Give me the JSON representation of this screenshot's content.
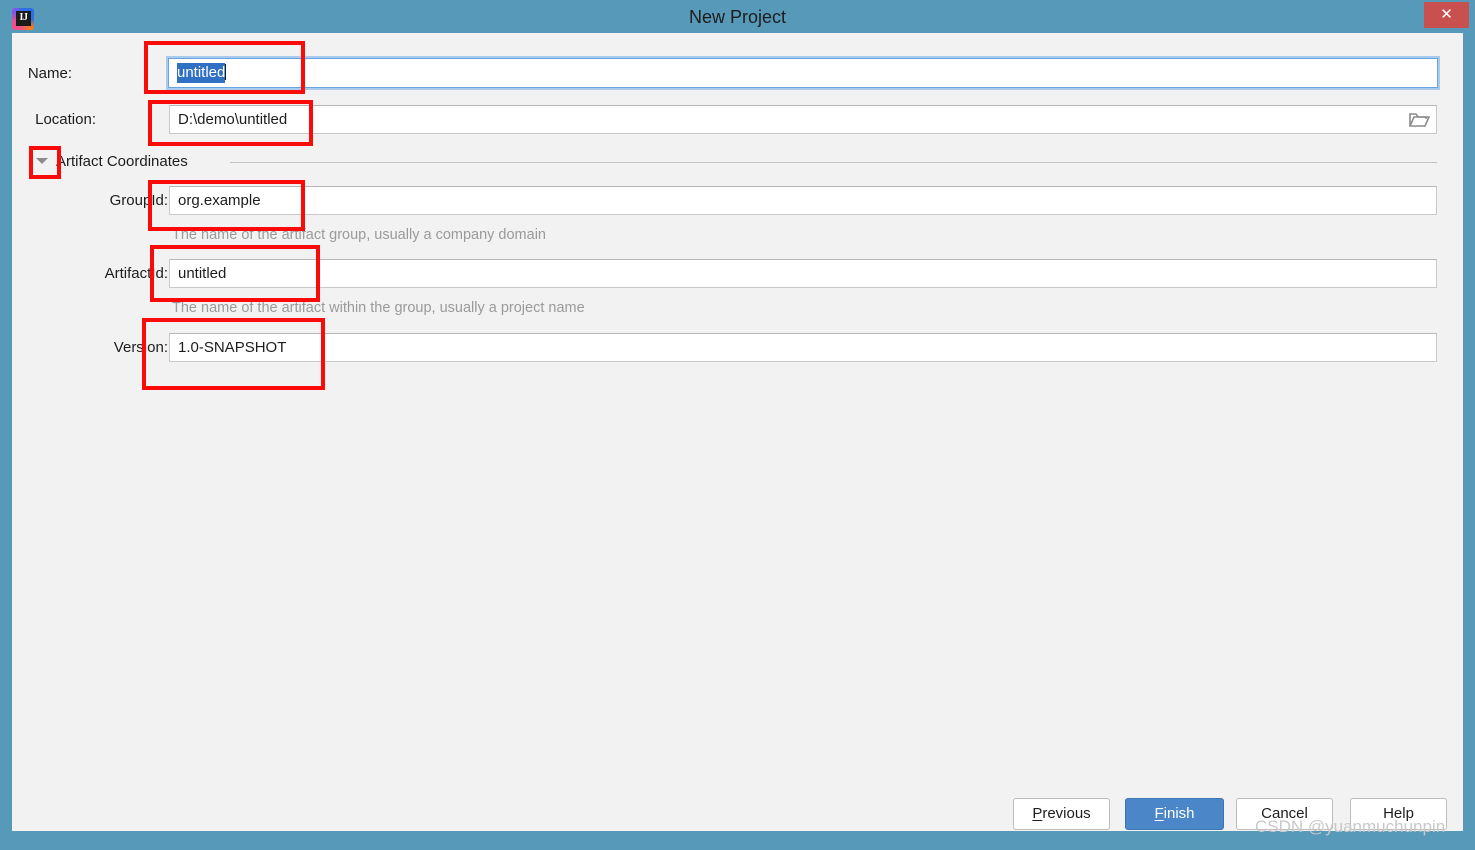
{
  "window": {
    "title": "New Project",
    "app_icon": "intellij-idea-icon",
    "icon_text": "IJ",
    "close_label": "✕",
    "accent_color": "#5699b8",
    "close_color": "#c8504f",
    "body_color": "#f2f2f2"
  },
  "form": {
    "name": {
      "label": "Name:",
      "value": "untitled",
      "selected": true,
      "focused": true
    },
    "location": {
      "label": "Location:",
      "value": "D:\\demo\\untitled",
      "browse_icon": "folder-icon"
    },
    "artifact_section": {
      "title": "Artifact Coordinates",
      "expanded": true,
      "toggle_icon": "chevron-down-icon"
    },
    "group_id": {
      "label": "GroupId:",
      "value": "org.example",
      "hint": "The name of the artifact group, usually a company domain"
    },
    "artifact_id": {
      "label": "ArtifactId:",
      "value": "untitled",
      "hint": "The name of the artifact within the group, usually a project name"
    },
    "version": {
      "label": "Version:",
      "value": "1.0-SNAPSHOT"
    }
  },
  "buttons": {
    "previous": {
      "label": "Previous",
      "mnemonic": "P"
    },
    "finish": {
      "label": "Finish",
      "mnemonic": "F",
      "primary": true,
      "color": "#4a86c8"
    },
    "cancel": {
      "label": "Cancel"
    },
    "help": {
      "label": "Help"
    }
  },
  "annotations": {
    "color": "#fb0a0a",
    "boxes": [
      "name-field-highlight",
      "location-field-highlight",
      "artifact-toggle-highlight",
      "groupid-field-highlight",
      "artifactid-field-highlight",
      "version-field-highlight"
    ]
  },
  "watermark": {
    "text": "CSDN @yuanmuchunpin"
  }
}
